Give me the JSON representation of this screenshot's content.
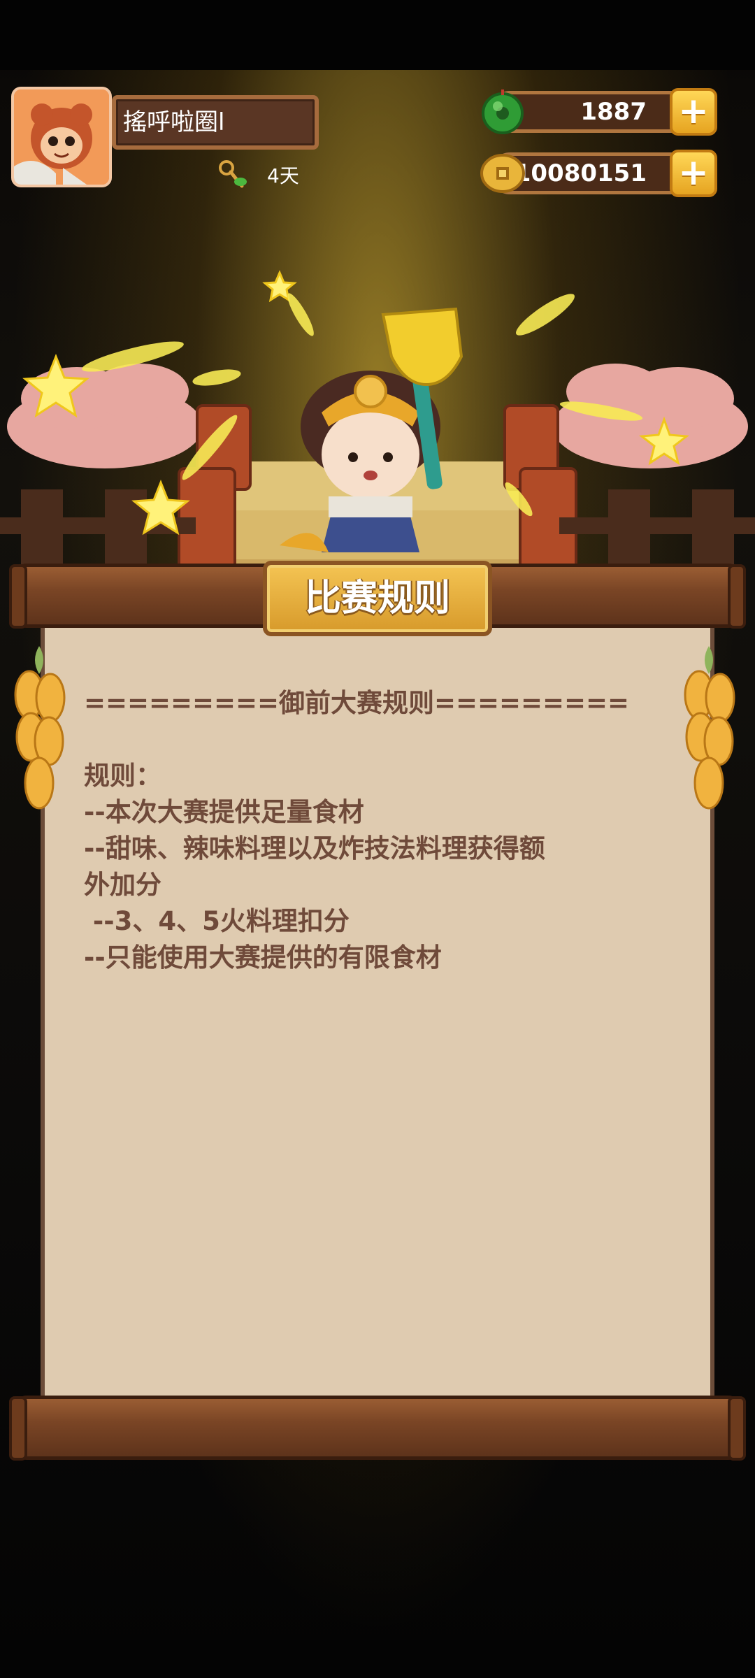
{
  "player": {
    "name": "搖呼啦圈l",
    "days": "4天"
  },
  "currency": {
    "jade": "1887",
    "coins": "10080151"
  },
  "panel": {
    "title": "比赛规则",
    "lines": [
      "=========御前大赛规则=========",
      "",
      "规则：",
      "--本次大赛提供足量食材",
      "--甜味、辣味料理以及炸技法料理获得额",
      "外加分",
      " --3、4、5火料理扣分",
      "--只能使用大赛提供的有限食材"
    ]
  }
}
